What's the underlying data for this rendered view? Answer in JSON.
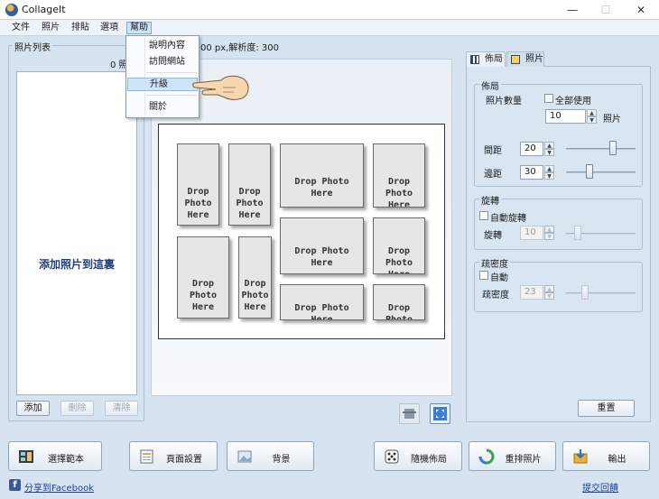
{
  "window": {
    "title": "CollageIt",
    "minimize": "—",
    "maximize": "☐",
    "close": "✕"
  },
  "menu": [
    "文件",
    "照片",
    "排貼",
    "選項",
    "幫助"
  ],
  "help_menu": [
    "說明內容",
    "訪問網站",
    "升級",
    "關於"
  ],
  "info_bar": "00 px,解析度: 300",
  "left_panel": {
    "title": "照片列表",
    "count": "0 照",
    "placeholder": "添加照片到這裏",
    "buttons": {
      "add": "添加",
      "delete": "刪除",
      "clear": "清除"
    }
  },
  "slots": [
    "Drop\nPhoto\nHere",
    "Drop\nPhoto\nHere",
    "Drop Photo\nHere",
    "Drop\nPhoto\nHere",
    "Drop\nPhoto\nHere",
    "Drop\nPhoto\nHere",
    "Drop Photo\nHere",
    "Drop\nPhoto\nHere",
    "Drop Photo\nHere",
    "Drop\nPhoto\nHere"
  ],
  "right_panel": {
    "tabs": [
      "佈局",
      "照片"
    ],
    "layout_group": {
      "title": "佈局",
      "photo_count_label": "照片數量",
      "use_all_label": "全部使用",
      "photo_count_value": "10",
      "photo_unit": "照片",
      "spacing_label": "間距",
      "spacing_value": "20",
      "margin_label": "邊距",
      "margin_value": "30"
    },
    "rotation_group": {
      "title": "旋轉",
      "auto_label": "自動旋轉",
      "rotation_label": "旋轉",
      "rotation_value": "10"
    },
    "density_group": {
      "title": "疏密度",
      "auto_label": "自動",
      "density_label": "疏密度",
      "density_value": "23"
    },
    "reset": "重置"
  },
  "toolbar": [
    "選擇範本",
    "頁面設置",
    "背景",
    "隨機佈局",
    "重排照片",
    "輸出"
  ],
  "footer": {
    "share": "分享到Facebook",
    "feedback": "提交回饋"
  },
  "colors": {
    "accent": "#2f5fa8",
    "link": "#1c3f94",
    "background": "#d7e3f0"
  }
}
